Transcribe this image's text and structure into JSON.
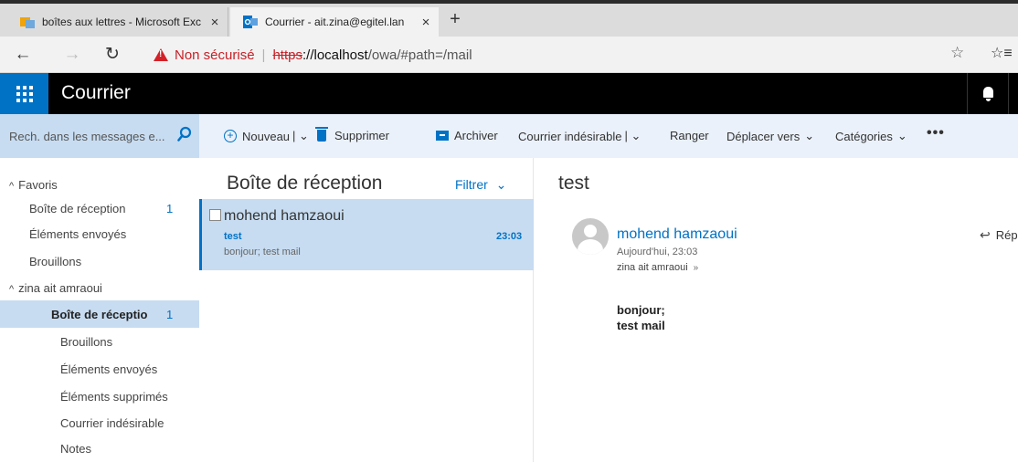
{
  "browser": {
    "tabs": [
      {
        "title": "boîtes aux lettres - Microsoft Exc",
        "close": "×"
      },
      {
        "title": "Courrier - ait.zina@egitel.lan",
        "close": "×"
      }
    ],
    "new_tab": "+",
    "nav": {
      "back": "←",
      "forward": "→",
      "reload": "↻"
    },
    "address": {
      "insecure_label": "Non sécurisé",
      "separator": "|",
      "protocol": "https",
      "host": "://localhost",
      "path": "/owa/#path=/mail"
    },
    "star": "☆",
    "favorites": "☆≡"
  },
  "app": {
    "title": "Courrier",
    "accent": "#0072c6"
  },
  "search": {
    "placeholder": "Rech. dans les messages e..."
  },
  "toolbar": {
    "new": "Nouveau",
    "new_split": "| ⌄",
    "delete": "Supprimer",
    "archive": "Archiver",
    "junk": "Courrier indésirable",
    "junk_split": "| ⌄",
    "sweep": "Ranger",
    "move": "Déplacer vers",
    "move_chev": "⌄",
    "categories": "Catégories",
    "categories_chev": "⌄",
    "more": "•••"
  },
  "folders": {
    "favorites_header": "Favoris",
    "favorites": [
      {
        "label": "Boîte de réception",
        "count": "1"
      },
      {
        "label": "Éléments envoyés"
      },
      {
        "label": "Brouillons"
      }
    ],
    "account_header": "zina ait amraoui",
    "account": [
      {
        "label": "Boîte de réceptio",
        "count": "1"
      },
      {
        "label": "Brouillons"
      },
      {
        "label": "Éléments envoyés"
      },
      {
        "label": "Éléments supprimés"
      },
      {
        "label": "Courrier indésirable"
      },
      {
        "label": "Notes"
      }
    ],
    "collapse_glyph": "^"
  },
  "message_list": {
    "title": "Boîte de réception",
    "filter": "Filtrer",
    "filter_chev": "⌄",
    "messages": [
      {
        "sender": "mohend hamzaoui",
        "subject": "test",
        "time": "23:03",
        "preview": "bonjour; test mail"
      }
    ]
  },
  "reading_pane": {
    "subject": "test",
    "sender": "mohend hamzaoui",
    "date": "Aujourd'hui, 23:03",
    "to": "zina ait amraoui",
    "to_chev": "»",
    "body_line1": "bonjour;",
    "body_line2": "test mail",
    "reply": "Rép",
    "reply_icon": "↩"
  }
}
